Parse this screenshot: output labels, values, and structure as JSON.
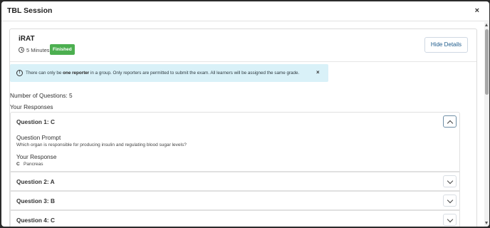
{
  "modal": {
    "title": "TBL Session",
    "close_symbol": "×"
  },
  "card": {
    "title": "iRAT",
    "icon": "clock-icon",
    "duration": "5 Minutes",
    "status_badge": "Finished",
    "status_color": "#4caf50",
    "hide_details_label": "Hide Details"
  },
  "alert": {
    "icon": "exclamation-circle-icon",
    "text_before": "There can only be ",
    "text_bold": "one reporter",
    "text_after": " in a group. Only reporters are permitted to submit the exam. All learners will be assigned the same grade.",
    "close_symbol": "×",
    "background_color": "#d9f1f8"
  },
  "summary": {
    "num_questions": "Number of Questions: 5",
    "your_responses": "Your Responses"
  },
  "questions": [
    {
      "header": "Question 1: C",
      "expanded": true,
      "prompt_label": "Question Prompt",
      "prompt_text": "Which organ is responsible for producing insulin and regulating blood sugar levels?",
      "response_label": "Your Response",
      "response_letter": "C",
      "response_text": "Pancreas"
    },
    {
      "header": "Question 2: A",
      "expanded": false
    },
    {
      "header": "Question 3: B",
      "expanded": false
    },
    {
      "header": "Question 4: C",
      "expanded": false
    }
  ],
  "accent_color": "#1d5b8c"
}
